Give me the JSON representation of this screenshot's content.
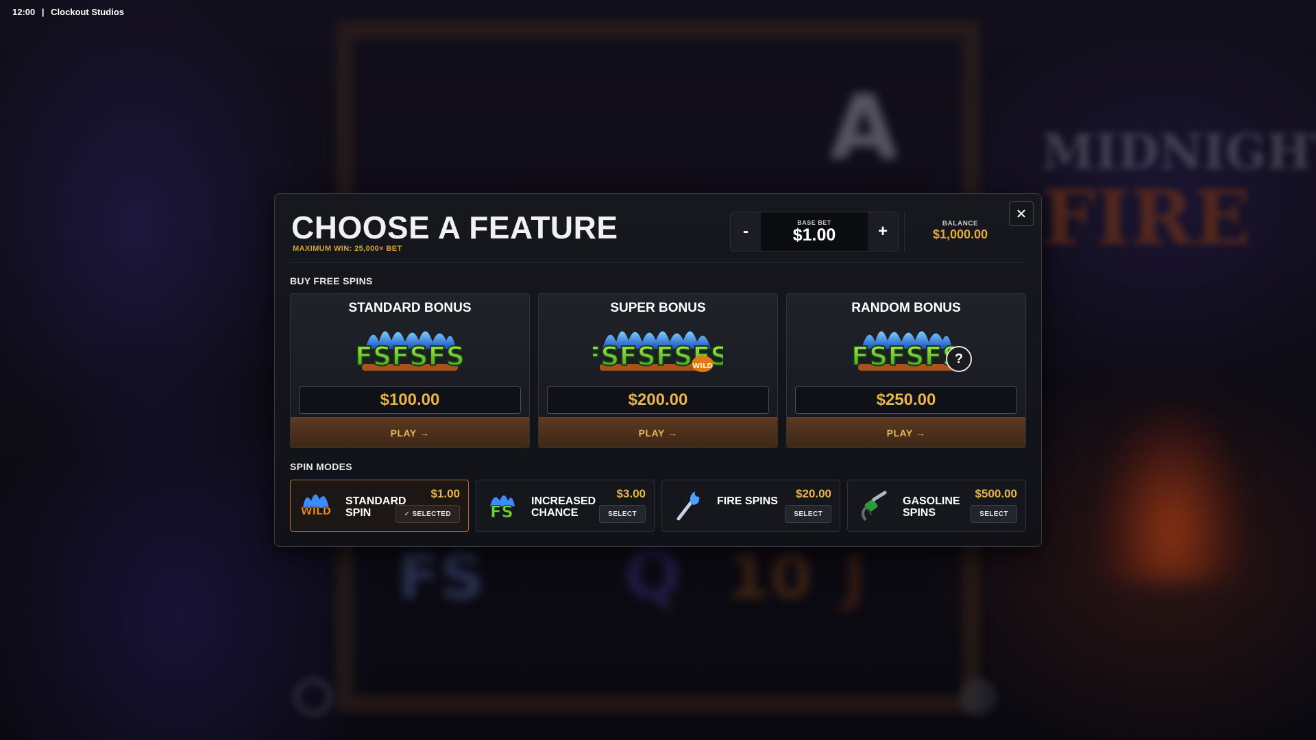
{
  "status": {
    "time": "12:00",
    "separator": "|",
    "studio": "Clockout Studios"
  },
  "background": {
    "game_title_line1": "MIDNIGHT",
    "game_title_line2": "FIRE",
    "reel_symbols": [
      "A",
      "FS",
      "Q",
      "10",
      "J"
    ]
  },
  "modal": {
    "title": "CHOOSE A FEATURE",
    "subtitle": "MAXIMUM WIN: 25,000× BET",
    "close_icon": "close-icon",
    "bet": {
      "minus": "-",
      "label": "BASE BET",
      "value": "$1.00",
      "plus": "+"
    },
    "balance": {
      "label": "BALANCE",
      "value": "$1,000.00"
    },
    "buy_section_label": "BUY FREE SPINS",
    "bonuses": [
      {
        "title": "STANDARD BONUS",
        "price": "$100.00",
        "play": "PLAY →",
        "art": "FSFSFS",
        "art_badge": ""
      },
      {
        "title": "SUPER BONUS",
        "price": "$200.00",
        "play": "PLAY →",
        "art": "FSFSFSFS",
        "art_badge": "WILD"
      },
      {
        "title": "RANDOM BONUS",
        "price": "$250.00",
        "play": "PLAY →",
        "art": "FSFSFS",
        "art_badge": "?"
      }
    ],
    "modes_section_label": "SPIN MODES",
    "modes": [
      {
        "name": "STANDARD SPIN",
        "price": "$1.00",
        "button": "✓ SELECTED",
        "selected": true,
        "icon": "wild-icon",
        "icon_text": "WILD"
      },
      {
        "name": "INCREASED CHANCE",
        "price": "$3.00",
        "button": "SELECT",
        "selected": false,
        "icon": "fs-icon",
        "icon_text": "FS"
      },
      {
        "name": "FIRE SPINS",
        "price": "$20.00",
        "button": "SELECT",
        "selected": false,
        "icon": "torch-icon",
        "icon_text": ""
      },
      {
        "name": "GASOLINE SPINS",
        "price": "$500.00",
        "button": "SELECT",
        "selected": false,
        "icon": "gas-nozzle-icon",
        "icon_text": ""
      }
    ]
  },
  "colors": {
    "accent_gold": "#e9b449",
    "play_brown": "#5a3a22",
    "selected_border": "#b36b36",
    "fs_green": "#6fd13a",
    "fs_blue_flame": "#3a8cff"
  }
}
